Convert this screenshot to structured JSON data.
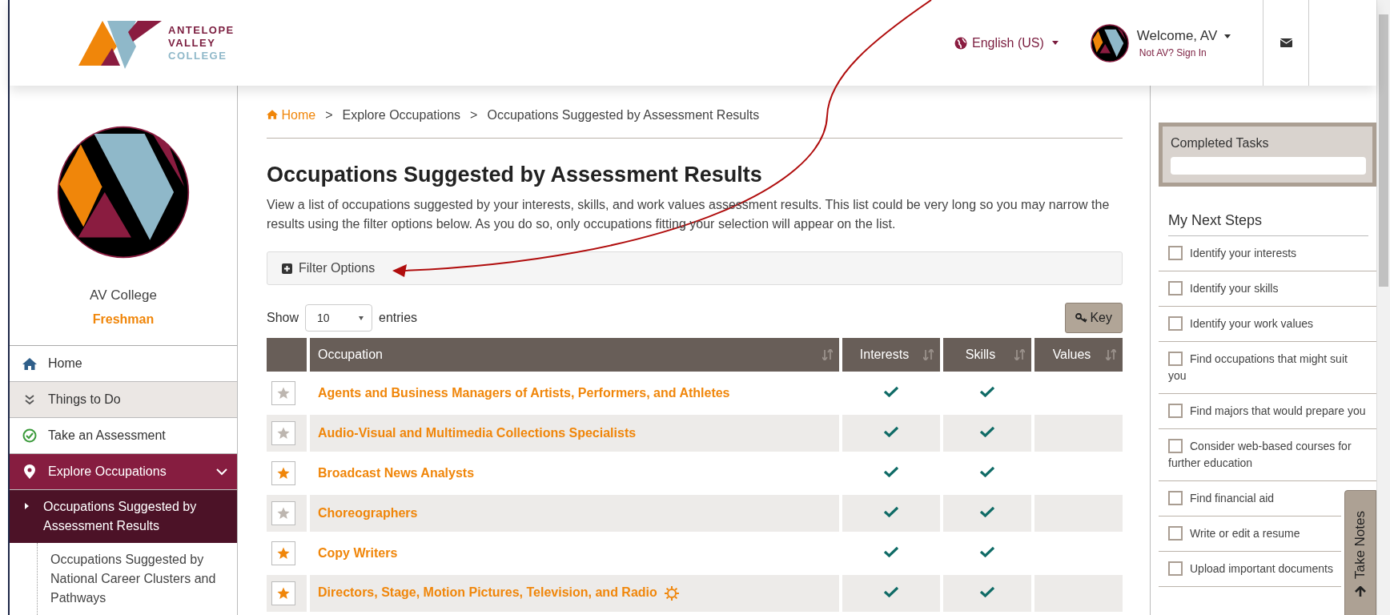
{
  "header": {
    "logo_lines": [
      "ANTELOPE",
      "VALLEY",
      "COLLEGE"
    ],
    "language": "English (US)",
    "welcome": "Welcome, AV",
    "sign_in": "Not AV? Sign In"
  },
  "profile": {
    "name": "AV College",
    "level": "Freshman"
  },
  "nav": [
    {
      "kind": "home",
      "label": "Home"
    },
    {
      "kind": "section",
      "label": "Things to Do"
    },
    {
      "kind": "assessment",
      "label": "Take an Assessment"
    },
    {
      "kind": "group",
      "label": "Explore Occupations",
      "expanded": true,
      "children": [
        {
          "label": "Occupations Suggested by Assessment Results",
          "selected": true
        },
        {
          "label": "Occupations Suggested by National Career Clusters and Pathways",
          "selected": false
        }
      ]
    }
  ],
  "breadcrumb": {
    "separator": ">",
    "items": [
      "Home",
      "Explore Occupations",
      "Occupations Suggested by Assessment Results"
    ]
  },
  "title": "Occupations Suggested by Assessment Results",
  "intro": "View a list of occupations suggested by your interests, skills, and work values assessment results. This list could be very long so you may narrow the results using the filter options below. As you do so, only occupations fitting your selection will appear on the list.",
  "filter": {
    "label": "Filter Options",
    "expanded": false
  },
  "entries": {
    "show": "Show",
    "value": "10",
    "suffix": "entries"
  },
  "key_button": "Key",
  "table": {
    "columns": [
      "Occupation",
      "Interests",
      "Skills",
      "Values"
    ],
    "rows": [
      {
        "occupation": "Agents and Business Managers of Artists, Performers, and Athletes",
        "favorite": false,
        "interests": true,
        "skills": true,
        "badge": false
      },
      {
        "occupation": "Audio-Visual and Multimedia Collections Specialists",
        "favorite": false,
        "interests": true,
        "skills": true,
        "badge": false
      },
      {
        "occupation": "Broadcast News Analysts",
        "favorite": true,
        "interests": true,
        "skills": true,
        "badge": false
      },
      {
        "occupation": "Choreographers",
        "favorite": false,
        "interests": true,
        "skills": true,
        "badge": false
      },
      {
        "occupation": "Copy Writers",
        "favorite": true,
        "interests": true,
        "skills": true,
        "badge": false
      },
      {
        "occupation": "Directors, Stage, Motion Pictures, Television, and Radio",
        "favorite": true,
        "interests": true,
        "skills": true,
        "badge": true
      }
    ]
  },
  "completed_tasks": {
    "title": "Completed Tasks"
  },
  "next_steps": {
    "title": "My Next Steps",
    "items": [
      {
        "label": "Identify your interests",
        "checked": false
      },
      {
        "label": "Identify your skills",
        "checked": false
      },
      {
        "label": "Identify your work values",
        "checked": false
      },
      {
        "label": "Find occupations that might suit you",
        "checked": false
      },
      {
        "label": "Find majors that would prepare you",
        "checked": false
      },
      {
        "label": "Consider web-based courses for further education",
        "checked": false
      },
      {
        "label": "Find financial aid",
        "checked": false
      },
      {
        "label": "Write or edit a resume",
        "checked": false
      },
      {
        "label": "Upload important documents",
        "checked": false
      }
    ]
  },
  "take_notes": "Take Notes"
}
